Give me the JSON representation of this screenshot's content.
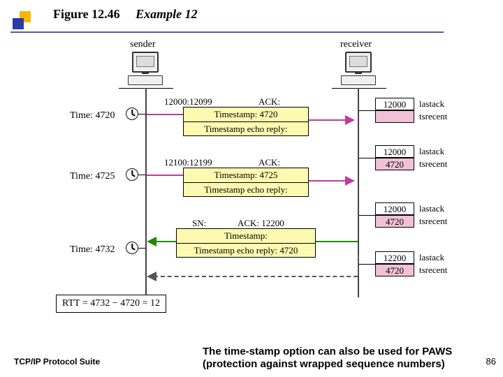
{
  "title": {
    "figure": "Figure 12.46",
    "example": "Example 12"
  },
  "actors": {
    "sender": "sender",
    "receiver": "receiver"
  },
  "times": {
    "t1": "Time: 4720",
    "t2": "Time: 4725",
    "t3": "Time: 4732"
  },
  "msg1": {
    "header_left": "12000:12099",
    "header_right": "ACK:",
    "line2": "Timestamp: 4720",
    "line3": "Timestamp echo reply:"
  },
  "msg2": {
    "header_left": "12100:12199",
    "header_right": "ACK:",
    "line2": "Timestamp: 4725",
    "line3": "Timestamp echo reply:"
  },
  "msg3": {
    "header_left": "SN:",
    "header_right": "ACK: 12200",
    "line2": "Timestamp:",
    "line3": "Timestamp echo reply: 4720"
  },
  "state1": {
    "top": "12000",
    "bot": "",
    "lab1": "lastack",
    "lab2": "tsrecent"
  },
  "state2": {
    "top": "12000",
    "bot": "4720",
    "lab1": "lastack",
    "lab2": "tsrecent"
  },
  "state3": {
    "top": "12000",
    "bot": "4720",
    "lab1": "lastack",
    "lab2": "tsrecent"
  },
  "state4": {
    "top": "12200",
    "bot": "4720",
    "lab1": "lastack",
    "lab2": "tsrecent"
  },
  "rtt": "RTT = 4732 − 4720 = 12",
  "footer_left": "TCP/IP Protocol Suite",
  "footer_note": "The time-stamp option can also be used for PAWS (protection against wrapped sequence numbers)",
  "slide_num": "86"
}
